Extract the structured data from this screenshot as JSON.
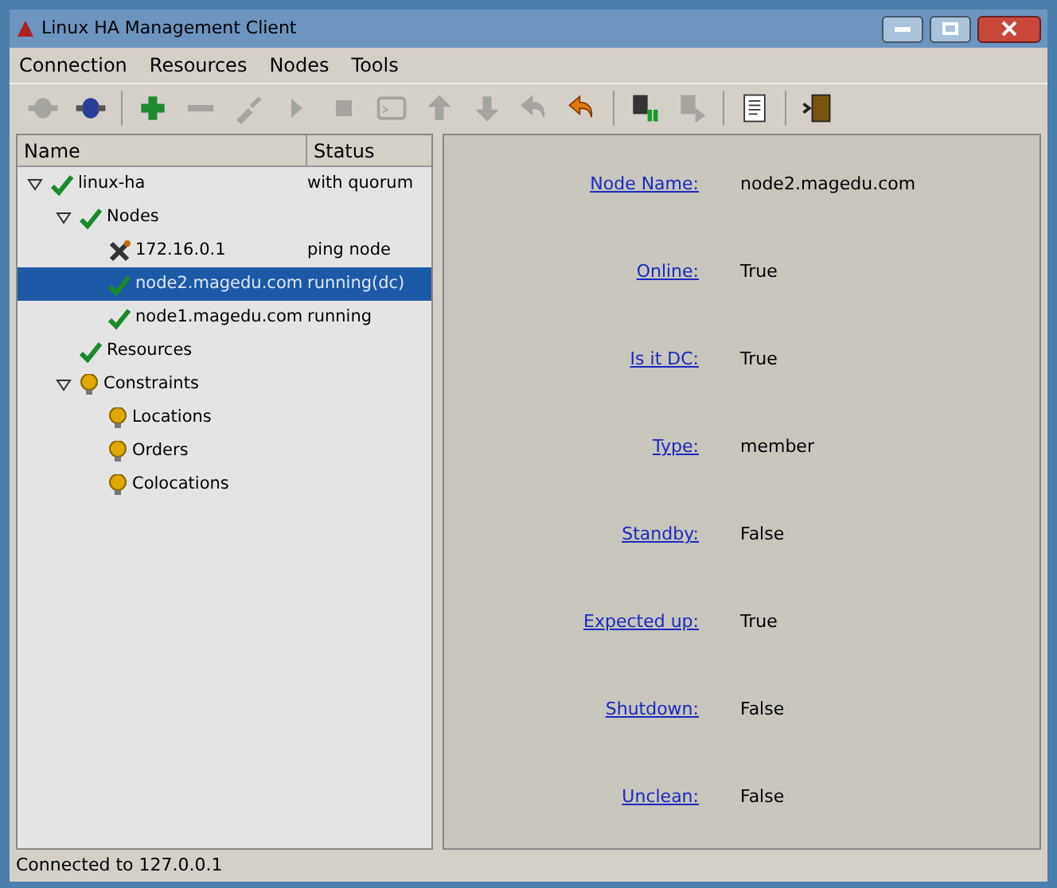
{
  "window": {
    "title": "Linux HA Management Client"
  },
  "menu": [
    "Connection",
    "Resources",
    "Nodes",
    "Tools"
  ],
  "toolbar": [
    {
      "kind": "connect",
      "disabled": true
    },
    {
      "kind": "disconnect",
      "disabled": false
    },
    {
      "kind": "separator",
      "disabled": false
    },
    {
      "kind": "add",
      "disabled": false
    },
    {
      "kind": "remove",
      "disabled": true
    },
    {
      "kind": "cleanup",
      "disabled": true
    },
    {
      "kind": "start",
      "disabled": true
    },
    {
      "kind": "stop",
      "disabled": true
    },
    {
      "kind": "console",
      "disabled": true
    },
    {
      "kind": "up",
      "disabled": true
    },
    {
      "kind": "down",
      "disabled": true
    },
    {
      "kind": "undo",
      "disabled": true
    },
    {
      "kind": "revert",
      "disabled": false
    },
    {
      "kind": "separator",
      "disabled": false
    },
    {
      "kind": "standby",
      "disabled": false
    },
    {
      "kind": "active",
      "disabled": true
    },
    {
      "kind": "separator",
      "disabled": false
    },
    {
      "kind": "log",
      "disabled": false
    },
    {
      "kind": "separator",
      "disabled": false
    },
    {
      "kind": "exit",
      "disabled": false
    }
  ],
  "tree": {
    "columns": [
      "Name",
      "Status"
    ],
    "items": [
      {
        "name": "linux-ha",
        "status": "with quorum",
        "kind": "ok",
        "expanded": true,
        "selected": false,
        "children": [
          {
            "name": "Nodes",
            "kind": "ok",
            "expanded": true,
            "selected": false,
            "children": [
              {
                "name": "172.16.0.1",
                "status": "ping node",
                "kind": "ping",
                "selected": false
              },
              {
                "name": "node2.magedu.com",
                "status": "running(dc)",
                "kind": "ok",
                "selected": true
              },
              {
                "name": "node1.magedu.com",
                "status": "running",
                "kind": "ok",
                "selected": false
              }
            ]
          },
          {
            "name": "Resources",
            "kind": "ok",
            "selected": false
          },
          {
            "name": "Constraints",
            "kind": "constraint",
            "expanded": true,
            "selected": false,
            "children": [
              {
                "name": "Locations",
                "kind": "constraint",
                "selected": false
              },
              {
                "name": "Orders",
                "kind": "constraint",
                "selected": false
              },
              {
                "name": "Colocations",
                "kind": "constraint",
                "selected": false
              }
            ]
          }
        ]
      }
    ]
  },
  "details": [
    {
      "label": "Node Name:",
      "value": "node2.magedu.com"
    },
    {
      "label": "Online:",
      "value": "True"
    },
    {
      "label": "Is it DC:",
      "value": "True"
    },
    {
      "label": "Type:",
      "value": "member"
    },
    {
      "label": "Standby:",
      "value": "False"
    },
    {
      "label": "Expected up:",
      "value": "True"
    },
    {
      "label": "Shutdown:",
      "value": "False"
    },
    {
      "label": "Unclean:",
      "value": "False"
    }
  ],
  "status_bar": "Connected to 127.0.0.1"
}
